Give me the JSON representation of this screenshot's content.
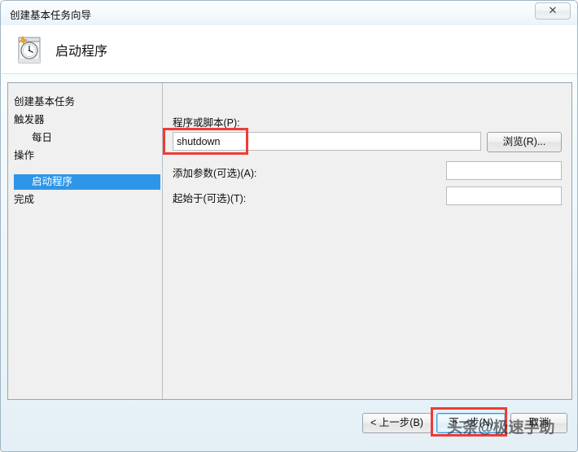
{
  "window": {
    "title": "创建基本任务向导",
    "close_label": "✕",
    "close_icon": "close-icon"
  },
  "header": {
    "icon": "task-scheduler-clock-calendar-icon",
    "title": "启动程序"
  },
  "sidebar": {
    "items": [
      {
        "label": "创建基本任务",
        "indent": false,
        "selected": false
      },
      {
        "label": "触发器",
        "indent": false,
        "selected": false
      },
      {
        "label": "每日",
        "indent": true,
        "selected": false
      },
      {
        "label": "操作",
        "indent": false,
        "selected": false
      },
      {
        "label": "启动程序",
        "indent": true,
        "selected": true
      },
      {
        "label": "完成",
        "indent": false,
        "selected": false
      }
    ]
  },
  "form": {
    "program_label": "程序或脚本(P):",
    "program_value": "shutdown",
    "program_placeholder": "",
    "browse_label": "浏览(R)...",
    "arguments_label": "添加参数(可选)(A):",
    "arguments_value": "",
    "startin_label": "起始于(可选)(T):",
    "startin_value": ""
  },
  "footer": {
    "back_label": "< 上一步(B)",
    "next_label": "下一步(N)",
    "cancel_label": "取消"
  },
  "watermark": {
    "text": "头条@极速手助"
  },
  "colors": {
    "accent_selection": "#2e96e8",
    "annotation_red": "#ef3b36",
    "content_bg": "#eff0ef",
    "header_bg": "#ffffff"
  }
}
